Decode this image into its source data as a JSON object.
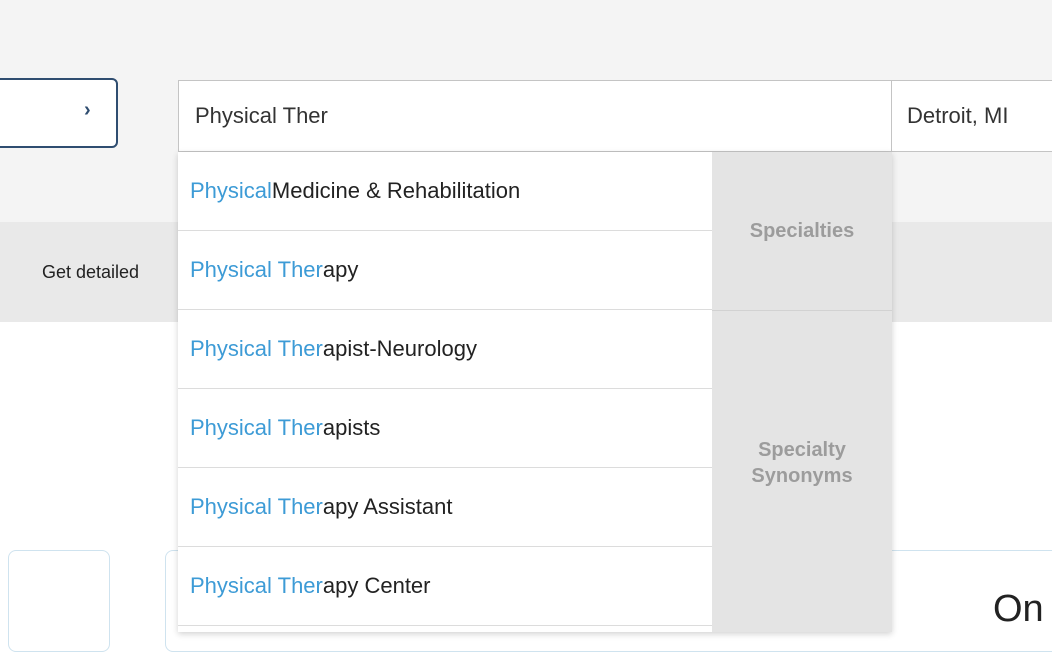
{
  "search": {
    "query": "Physical Ther",
    "location": "Detroit, MI"
  },
  "left_control": {
    "chevron": "›"
  },
  "info_bar": {
    "text": "Get detailed"
  },
  "dropdown": {
    "items": [
      {
        "match": "Physical",
        "rest": " Medicine & Rehabilitation"
      },
      {
        "match": "Physical Ther",
        "rest": "apy"
      },
      {
        "match": "Physical Ther",
        "rest": "apist-Neurology"
      },
      {
        "match": "Physical Ther",
        "rest": "apists"
      },
      {
        "match": "Physical Ther",
        "rest": "apy Assistant"
      },
      {
        "match": "Physical Ther",
        "rest": "apy Center"
      }
    ],
    "groups": {
      "specialties": "Specialties",
      "synonyms_line1": "Specialty",
      "synonyms_line2": "Synonyms"
    }
  },
  "page": {
    "bottom_partial_text": "On"
  },
  "colors": {
    "match_highlight": "#3d9bd6",
    "accent_border": "#2f4d70",
    "group_label": "#9c9c9c"
  }
}
